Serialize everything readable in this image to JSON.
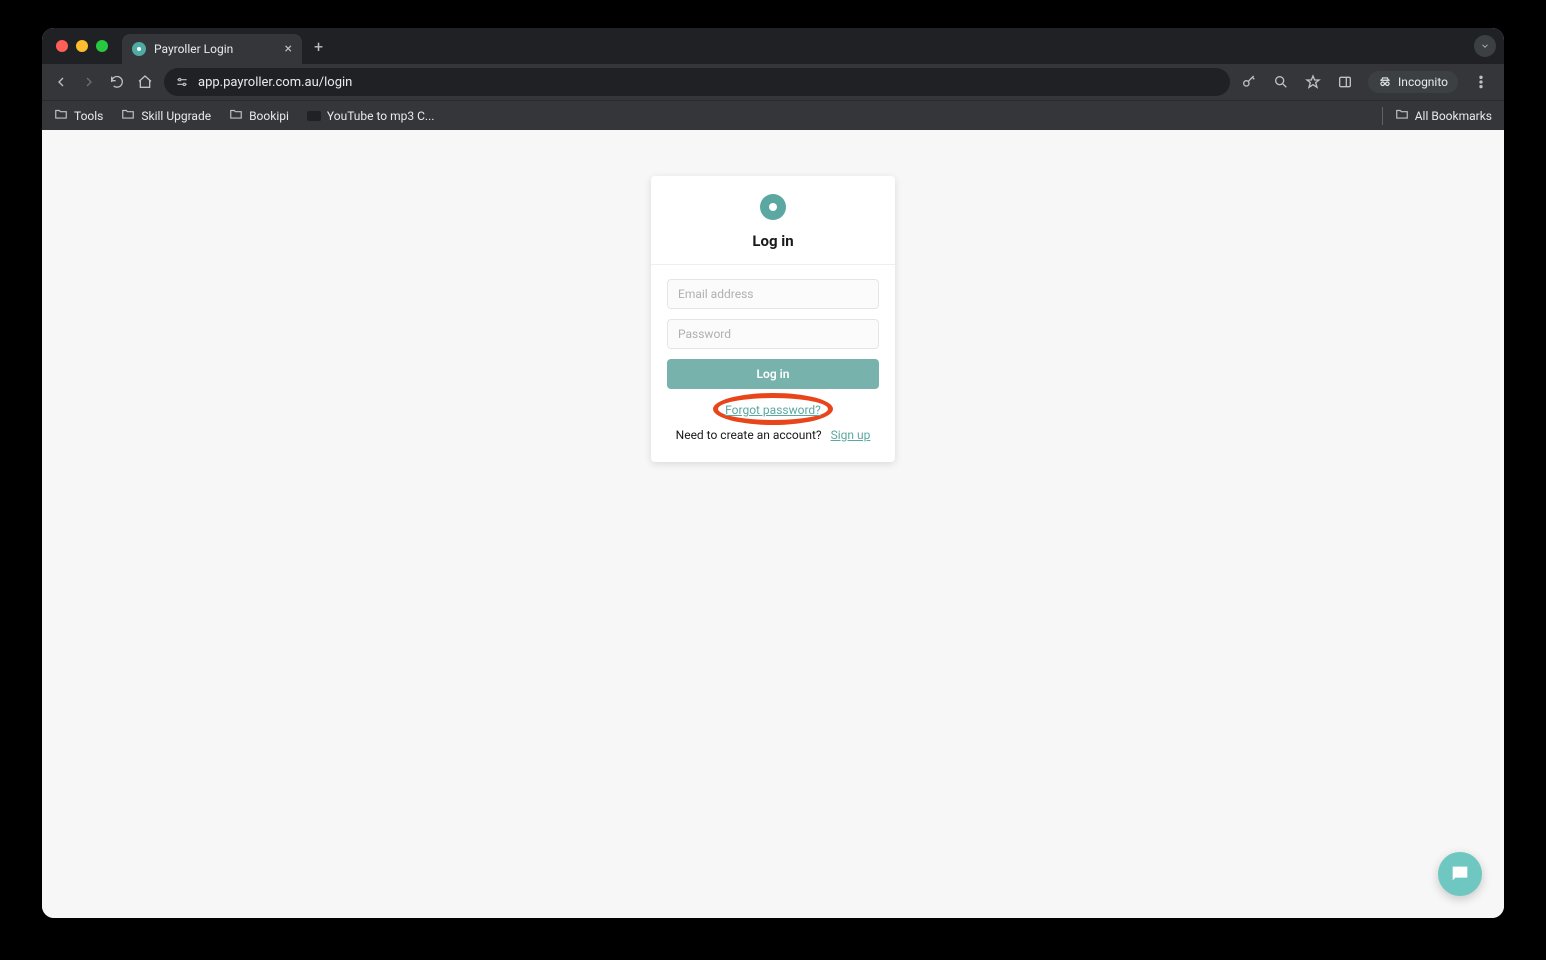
{
  "browser": {
    "tab_title": "Payroller Login",
    "url": "app.payroller.com.au/login",
    "incognito_label": "Incognito"
  },
  "bookmarks": {
    "items": [
      {
        "label": "Tools"
      },
      {
        "label": "Skill Upgrade"
      },
      {
        "label": "Bookipi"
      },
      {
        "label": "YouTube to mp3 C..."
      }
    ],
    "all_label": "All Bookmarks"
  },
  "login": {
    "title": "Log in",
    "email_placeholder": "Email address",
    "password_placeholder": "Password",
    "button_label": "Log in",
    "forgot_label": "Forgot password?",
    "need_account_label": "Need to create an account?",
    "signup_label": "Sign up"
  }
}
